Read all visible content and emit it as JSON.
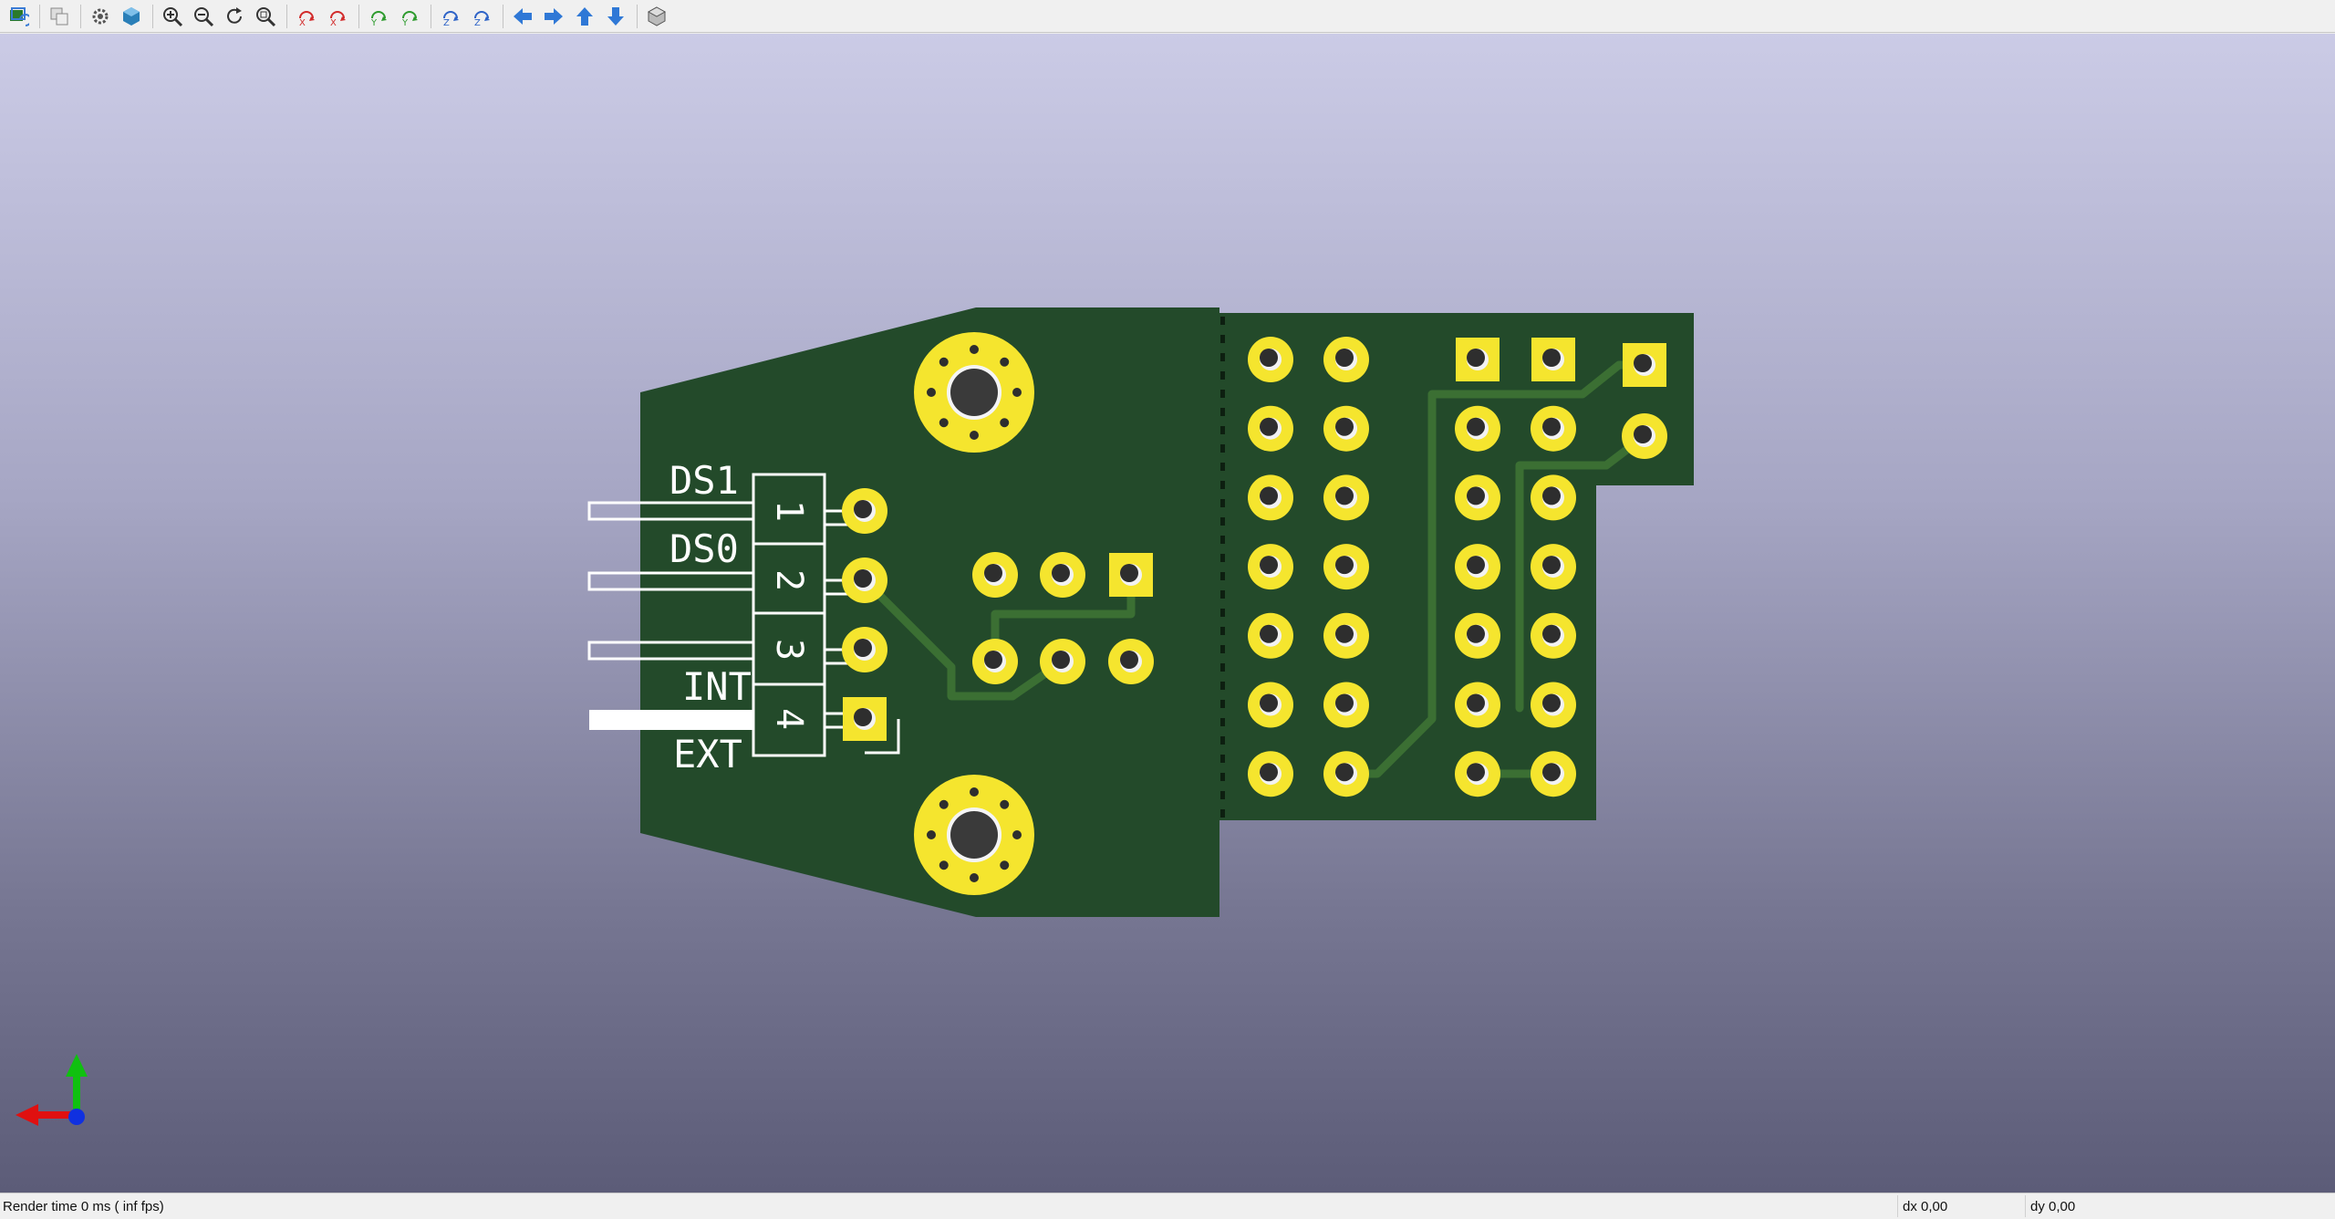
{
  "toolbar": {
    "buttons": [
      {
        "name": "reload-board-icon",
        "color": "#3a7bd5"
      },
      {
        "name": "copy-image-icon",
        "color": "#888888"
      },
      {
        "name": "settings-gear-icon",
        "color": "#555555"
      },
      {
        "name": "raytracing-cube-icon",
        "color": "#2a7fb8"
      },
      {
        "name": "zoom-in-icon",
        "color": "#333333"
      },
      {
        "name": "zoom-out-icon",
        "color": "#333333"
      },
      {
        "name": "redraw-icon",
        "color": "#333333"
      },
      {
        "name": "zoom-fit-icon",
        "color": "#333333"
      },
      {
        "name": "rotate-x-cw-icon",
        "color": "#d22b2b"
      },
      {
        "name": "rotate-x-ccw-icon",
        "color": "#d22b2b"
      },
      {
        "name": "rotate-y-cw-icon",
        "color": "#2e9b2e"
      },
      {
        "name": "rotate-y-ccw-icon",
        "color": "#2e9b2e"
      },
      {
        "name": "rotate-z-cw-icon",
        "color": "#2e63c7"
      },
      {
        "name": "rotate-z-ccw-icon",
        "color": "#2e63c7"
      },
      {
        "name": "move-left-icon",
        "color": "#2f78d6"
      },
      {
        "name": "move-right-icon",
        "color": "#2f78d6"
      },
      {
        "name": "move-up-icon",
        "color": "#2f78d6"
      },
      {
        "name": "move-down-icon",
        "color": "#2f78d6"
      },
      {
        "name": "orthographic-icon",
        "color": "#555555"
      }
    ]
  },
  "board": {
    "colors": {
      "substrate": "#234a2a",
      "copper_pad": "#f5e52e",
      "track": "#3b6f33",
      "silkscreen": "#ffffff",
      "hole": "#2e2e2e"
    },
    "silkscreen_labels": {
      "ds1": "DS1",
      "ds0": "DS0",
      "int": "INT",
      "ext": "EXT"
    },
    "pin_numbers": [
      "1",
      "2",
      "3",
      "4"
    ]
  },
  "axes": {
    "x_color": "#e01010",
    "y_color": "#10c010",
    "z_color": "#1030e0"
  },
  "status": {
    "render_time": "Render time 0 ms ( inf fps)",
    "dx": "dx 0,00",
    "dy": "dy 0,00"
  }
}
